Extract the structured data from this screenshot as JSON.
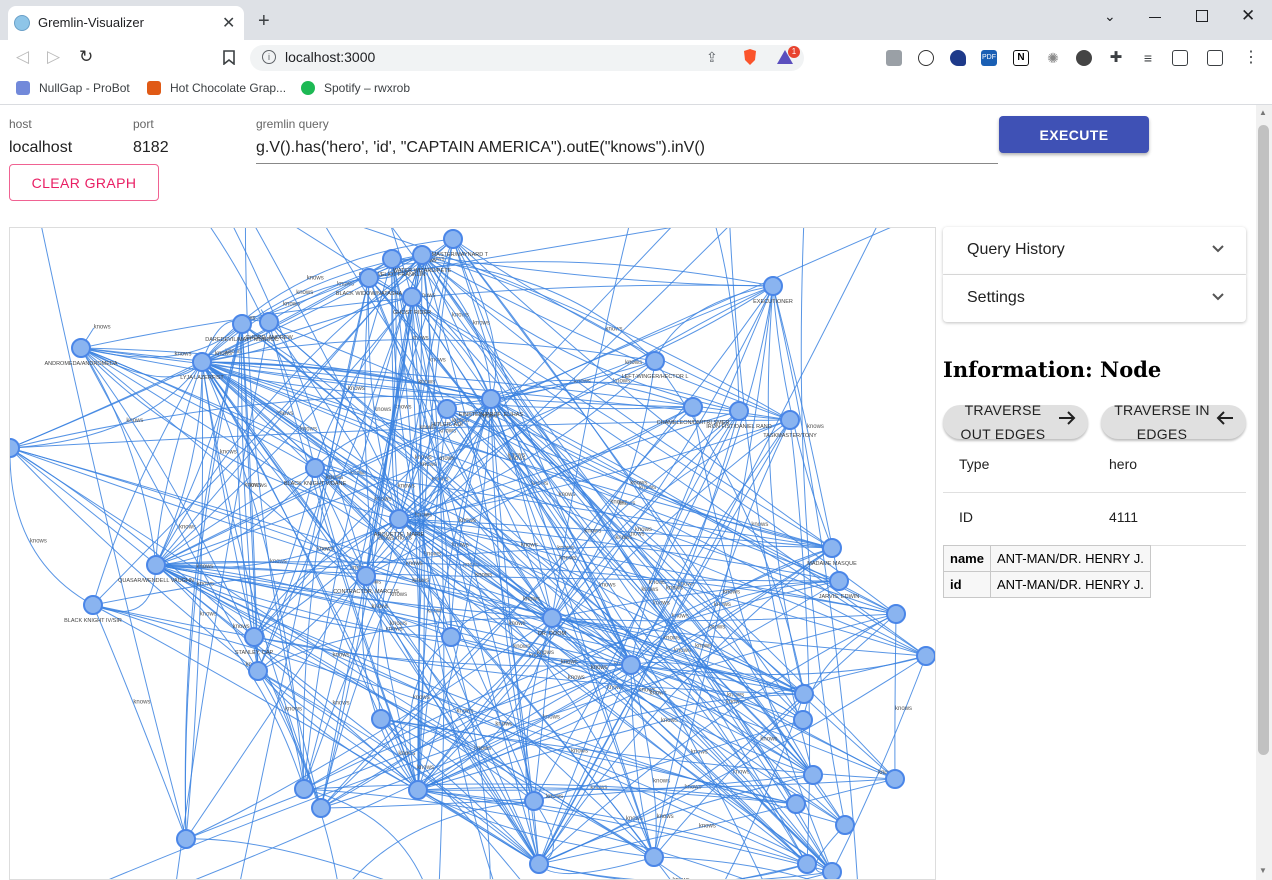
{
  "browser": {
    "tab_title": "Gremlin-Visualizer",
    "tab_close": "✕",
    "new_tab": "+",
    "url": "localhost:3000",
    "bookmarks": [
      {
        "label": "NullGap - ProBot",
        "icon": "probot-icon",
        "color": "#7289da"
      },
      {
        "label": "Hot Chocolate Grap...",
        "icon": "hot-chocolate-icon",
        "color": "#e05a16"
      },
      {
        "label": "Spotify – rwxrob",
        "icon": "spotify-icon",
        "color": "#1db954"
      }
    ],
    "brave_badge": "1"
  },
  "form": {
    "host_label": "host",
    "host_value": "localhost",
    "port_label": "port",
    "port_value": "8182",
    "query_label": "gremlin query",
    "query_value": "g.V().has('hero', 'id', \"CAPTAIN AMERICA\").outE(\"knows\").inV()",
    "execute_label": "EXECUTE",
    "clear_label": "CLEAR GRAPH"
  },
  "graph": {
    "edge_label": "knows",
    "edge_color": "#3b82e0",
    "node_fill": "#8ab4f0",
    "node_stroke": "#4a86e8",
    "node_labels": [
      "RINGMASTER/MAYNARD T",
      "CLOWN/ELIOT FRANKLIN",
      "WATER WIZARD/PETE",
      "BLACK WIDOW/NATASHA",
      "GHOST RIDER",
      "EXECUTIONER",
      "DAREDEVIL/MATT MURDOC",
      "CHORD, ANDREW",
      "ANDROMEDA/ANDROMEDA",
      "LYJA LAZERFIST",
      "LEFT-WINGER/HECTOR L",
      "HITLER, ADI",
      "EINSTEIN/PROF. ELIHAS",
      "CHAMELEON/DMITRI SMER",
      "IRON FIST/DANIEL RAND",
      "TASKMASTER/TONY",
      "BLACK KNIGHT V/DANE",
      "ARQUETTE, MARIE",
      "QUASAR/WENDELL VAUGHN",
      "MADAME MASQUE",
      "JARVIS, EDWIN",
      "BLACK KNIGHT IV/SIR",
      "CONTRACTOR, MARCUS",
      "DR. DOOM",
      "STANLEY, CAP"
    ]
  },
  "panels": [
    {
      "title": "Query History"
    },
    {
      "title": "Settings"
    }
  ],
  "info": {
    "heading": "Information: Node",
    "traverse_out_line1": "TRAVERSE",
    "traverse_out_line2": "OUT EDGES",
    "traverse_in_line1": "TRAVERSE IN",
    "traverse_in_line2": "EDGES",
    "type_label": "Type",
    "type_value": "hero",
    "id_label": "ID",
    "id_value": "4111",
    "properties": [
      {
        "key": "name",
        "value": "ANT-MAN/DR. HENRY J."
      },
      {
        "key": "id",
        "value": "ANT-MAN/DR. HENRY J."
      }
    ]
  }
}
